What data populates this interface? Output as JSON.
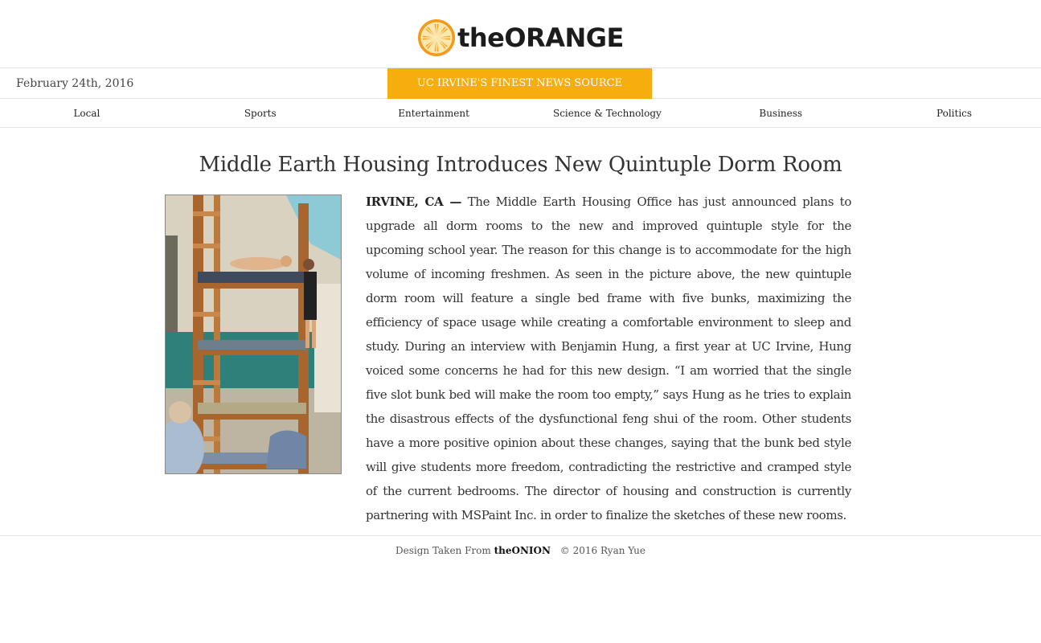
{
  "brand": {
    "name": "theORANGE",
    "accent_color": "#f6ae0f",
    "icon": "orange-slice-icon"
  },
  "infobar": {
    "date": "February 24th, 2016",
    "tagline": "UC IRVINE'S FINEST NEWS SOURCE"
  },
  "nav": {
    "items": [
      {
        "label": "Local"
      },
      {
        "label": "Sports"
      },
      {
        "label": "Entertainment"
      },
      {
        "label": "Science & Technology"
      },
      {
        "label": "Business"
      },
      {
        "label": "Politics"
      }
    ]
  },
  "article": {
    "headline": "Middle Earth Housing Introduces New Quintuple Dorm Room",
    "dateline": "IRVINE, CA —",
    "body": "The Middle Earth Housing Office has just announced plans to upgrade all dorm rooms to the new and improved quintuple style for the upcoming school year. The reason for this change is to accommodate for the high volume of incoming freshmen. As seen in the picture above, the new quintuple dorm room will feature a single bed frame with five bunks, maximizing the efficiency of space usage while creating a comfortable environment to sleep and study. During an interview with Benjamin Hung, a first year at UC Irvine, Hung voiced some concerns he had for this new design. “I am worried that the single five slot bunk bed will make the room too empty,” says Hung as he tries to explain the disastrous effects of the dysfunctional feng shui of the room. Other students have a more positive opinion about these changes, saying that the bunk bed style will give students more freedom, contradicting the restrictive and cramped style of the current bedrooms. The director of housing and construction is currently partnering with MSPaint Inc. in order to finalize the sketches of these new rooms."
  },
  "footer": {
    "credit_prefix": "Design Taken From",
    "credit_link": "theONION",
    "copyright": "© 2016 Ryan Yue"
  }
}
